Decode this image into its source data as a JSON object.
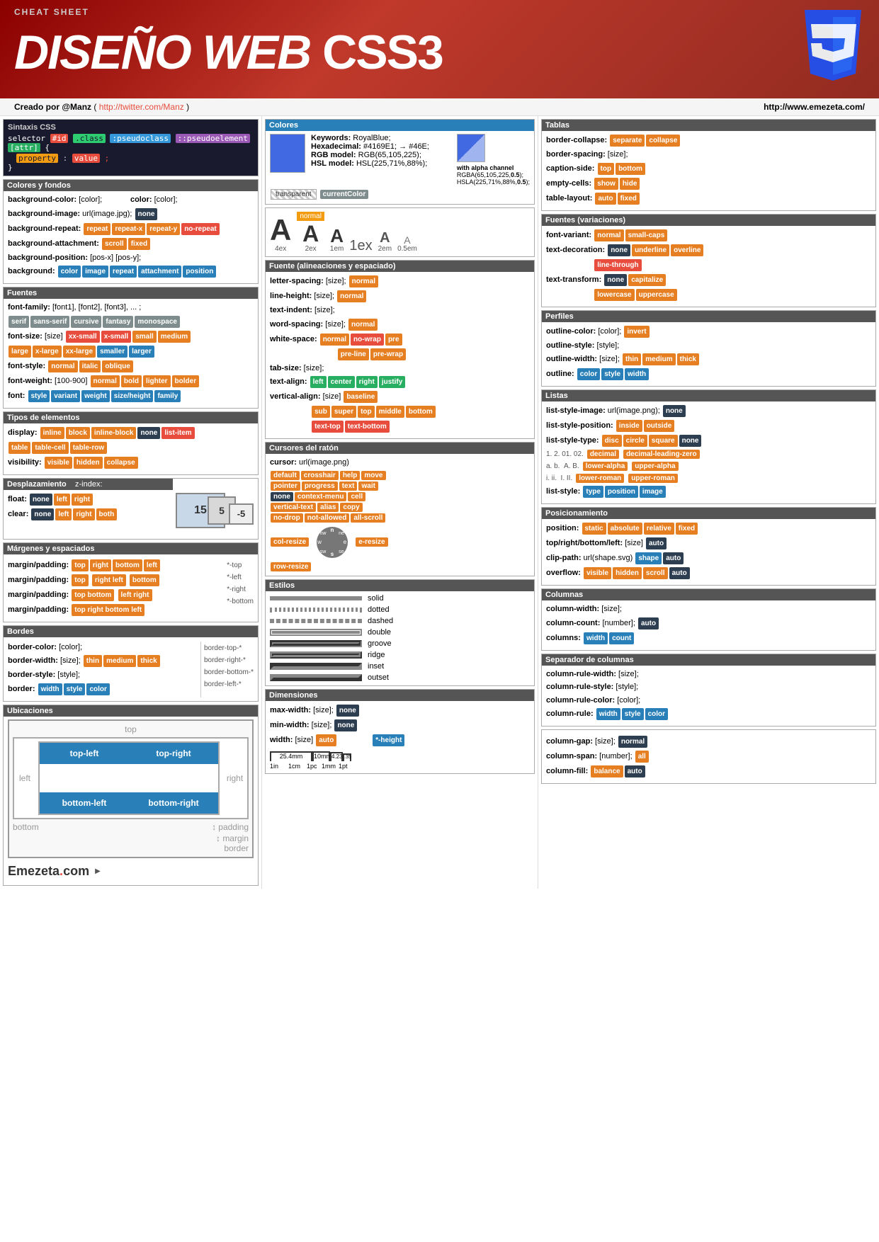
{
  "header": {
    "cheat_label": "CHEAT SHEET",
    "title": "DISEÑO WEB CSS3",
    "subtitle_left": "Creado por @Manz ( http://twitter.com/Manz )",
    "subtitle_right": "http://www.emezeta.com/"
  },
  "sintaxis": {
    "title": "Sintaxis CSS",
    "line1": "selector",
    "id": "#id",
    "class": ".class",
    "pseudo": ":pseudoclass",
    "pseudoel": "::pseudoelement",
    "attr": "[attr]",
    "property": "property",
    "value": "value"
  },
  "colores_section": {
    "title": "Colores",
    "keywords_label": "Keywords:",
    "keywords_val": "RoyalBlue;",
    "hex_label": "Hexadecimal:",
    "hex_val": "#4169E1; → #46E;",
    "rgb_label": "RGB model:",
    "rgb_val": "RGB(65,105,225);",
    "hsl_label": "HSL model:",
    "hsl_val": "HSL(225,71%,88%);",
    "alpha_label": "with alpha channel",
    "rgba_val": "RGBA(65,105,225,0.5);",
    "hsla_val": "HSLA(225,71%,88%,0.5);",
    "transparent": "transparent",
    "current": "currentColor"
  },
  "colores_fondos": {
    "title": "Colores y fondos",
    "props": [
      {
        "label": "background-color:",
        "vals": [
          "[color];"
        ],
        "extra": "color: [color];"
      },
      {
        "label": "background-image:",
        "vals": [
          "url(image.jpg);"
        ],
        "none": "none"
      },
      {
        "label": "background-repeat:",
        "tags": [
          "repeat",
          "repeat-x",
          "repeat-y",
          "no-repeat"
        ]
      },
      {
        "label": "background-attachment:",
        "tags": [
          "scroll",
          "fixed"
        ]
      },
      {
        "label": "background-position:",
        "vals": [
          "[pos-x] [pos-y];"
        ]
      },
      {
        "label": "background:",
        "tags": [
          "color",
          "image",
          "repeat",
          "attachment",
          "position"
        ]
      }
    ]
  },
  "fuentes": {
    "title": "Fuentes",
    "props": [
      {
        "label": "font-family:",
        "vals": [
          "[font1], [font2], [font3], ...;"
        ]
      },
      {
        "tags_serif": [
          "serif",
          "sans-serif",
          "cursive",
          "fantasy",
          "monospace"
        ]
      },
      {
        "label": "font-size:",
        "vals": [
          "[size]"
        ],
        "tags": [
          "xx-small",
          "x-small",
          "small",
          "medium",
          "large",
          "x-large",
          "xx-large",
          "smaller",
          "larger"
        ]
      },
      {
        "label": "font-style:",
        "tags": [
          "normal",
          "italic",
          "oblique"
        ]
      },
      {
        "label": "font-weight:",
        "vals": [
          "[100-900]"
        ],
        "tags": [
          "normal",
          "bold",
          "lighter",
          "bolder"
        ]
      },
      {
        "label": "font:",
        "tags": [
          "style",
          "variant",
          "weight",
          "size/height",
          "family"
        ]
      }
    ]
  },
  "tipos_elementos": {
    "title": "Tipos de elementos",
    "props": [
      {
        "label": "display:",
        "tags": [
          "inline",
          "block",
          "inline-block",
          "none",
          "list-item",
          "table",
          "table-cell",
          "table-row"
        ]
      },
      {
        "label": "visibility:",
        "tags": [
          "visible",
          "hidden",
          "collapse"
        ]
      }
    ]
  },
  "desplazamiento": {
    "title": "Desplazamiento",
    "zindex_label": "z-index:",
    "props": [
      {
        "label": "float:",
        "tags": [
          "none",
          "left",
          "right"
        ]
      },
      {
        "label": "clear:",
        "tags": [
          "none",
          "left",
          "right",
          "both"
        ]
      }
    ]
  },
  "margenes": {
    "title": "Márgenes y espaciados",
    "rows": [
      {
        "label": "margin/padding:",
        "tags": [
          "top",
          "right",
          "bottom",
          "left"
        ],
        "note": "*-top"
      },
      {
        "label": "margin/padding:",
        "tags": [
          "top",
          "right",
          "left"
        ],
        "tag2": [
          "bottom"
        ],
        "note": "*-left"
      },
      {
        "label": "margin/padding:",
        "tags": [
          "top",
          "left"
        ],
        "tag2": [
          "right"
        ],
        "note": "*-right"
      },
      {
        "label": "margin/padding:",
        "tags": [
          "top",
          "bottom"
        ],
        "tag2": [
          "left right"
        ],
        "note": ""
      },
      {
        "label": "margin/padding:",
        "tags": [
          "top right bottom left"
        ],
        "note": "*-bottom"
      }
    ]
  },
  "bordes": {
    "title": "Bordes",
    "props": [
      {
        "label": "border-color:",
        "vals": [
          "[color];"
        ]
      },
      {
        "label": "border-width:",
        "vals": [
          "[size];"
        ],
        "tags": [
          "thin",
          "medium",
          "thick"
        ]
      },
      {
        "label": "border-style:",
        "vals": [
          "[style];"
        ]
      },
      {
        "label": "border:",
        "tags": [
          "width",
          "style",
          "color"
        ]
      }
    ],
    "side_props": [
      "border-top-*",
      "border-right-*",
      "border-bottom-*",
      "border-left-*"
    ]
  },
  "ubicaciones": {
    "title": "Ubicaciones",
    "top": "top",
    "bottom": "bottom",
    "left": "left",
    "right": "right",
    "top_left": "top-left",
    "top_right": "top-right",
    "bottom_left": "bottom-left",
    "bottom_right": "bottom-right",
    "padding_label": "padding",
    "margin_label": "margin",
    "border_label": "border"
  },
  "fuente_alineaciones": {
    "title": "Fuente (alineaciones y espaciado)",
    "props": [
      {
        "label": "letter-spacing:",
        "vals": [
          "[size];"
        ],
        "tags": [
          "normal"
        ]
      },
      {
        "label": "line-height:",
        "vals": [
          "[size];"
        ],
        "tags": [
          "normal"
        ]
      },
      {
        "label": "text-indent:",
        "vals": [
          "[size];"
        ]
      },
      {
        "label": "word-spacing:",
        "vals": [
          "[size];"
        ],
        "tags": [
          "normal"
        ]
      },
      {
        "label": "white-space:",
        "tags": [
          "normal",
          "no-wrap",
          "pre",
          "pre-line",
          "pre-wrap"
        ]
      },
      {
        "label": "tab-size:",
        "vals": [
          "[size];"
        ]
      },
      {
        "label": "text-align:",
        "tags": [
          "left",
          "center",
          "right",
          "justify"
        ]
      },
      {
        "label": "vertical-align:",
        "vals": [
          "[size]"
        ],
        "tags": [
          "baseline",
          "sub",
          "super",
          "top",
          "middle",
          "bottom",
          "text-top",
          "text-bottom"
        ]
      }
    ]
  },
  "cursores": {
    "title": "Cursores del ratón",
    "cursor_url": "cursor: url(image.png)",
    "cursors": [
      [
        "default",
        "crosshair",
        "help",
        "move"
      ],
      [
        "pointer",
        "progress",
        "text",
        "wait"
      ],
      [
        "none",
        "context-menu",
        "cell"
      ],
      [
        "vertical-text",
        "alias",
        "copy"
      ],
      [
        "no-drop",
        "not-allowed",
        "all-scroll"
      ],
      [
        "col-resize"
      ],
      [
        "row-resize"
      ]
    ],
    "resize_tags": [
      "e-resize"
    ]
  },
  "estilos": {
    "title": "Estilos",
    "styles": [
      "solid",
      "dotted",
      "dashed",
      "double",
      "groove",
      "ridge",
      "inset",
      "outset"
    ]
  },
  "dimensiones": {
    "title": "Dimensiones",
    "props": [
      {
        "label": "max-width:",
        "vals": [
          "[size];"
        ],
        "tags": [
          "none"
        ]
      },
      {
        "label": "min-width:",
        "vals": [
          "[size];"
        ],
        "tags": [
          "none"
        ]
      },
      {
        "label": "width:",
        "vals": [
          "[size]"
        ],
        "tags": [
          "auto"
        ]
      }
    ],
    "height_tag": "*-height",
    "ruler": [
      "25.4mm",
      "10mm",
      "4.23mm",
      "0.35mm",
      "1in",
      "1cm",
      "1pc",
      "1mm",
      "1pt"
    ]
  },
  "tablas": {
    "title": "Tablas",
    "props": [
      {
        "label": "border-collapse:",
        "tags": [
          "separate",
          "collapse"
        ]
      },
      {
        "label": "border-spacing:",
        "vals": [
          "[size];"
        ]
      },
      {
        "label": "caption-side:",
        "tags": [
          "top",
          "bottom"
        ]
      },
      {
        "label": "empty-cells:",
        "tags": [
          "show",
          "hide"
        ]
      },
      {
        "label": "table-layout:",
        "tags": [
          "auto",
          "fixed"
        ]
      }
    ]
  },
  "fuentes_variaciones": {
    "title": "Fuentes (variaciones)",
    "props": [
      {
        "label": "font-variant:",
        "tags": [
          "normal",
          "small-caps"
        ]
      },
      {
        "label": "text-decoration:",
        "tags": [
          "none",
          "underline",
          "overline",
          "line-through"
        ]
      },
      {
        "label": "text-transform:",
        "tags": [
          "none",
          "capitalize",
          "lowercase",
          "uppercase"
        ]
      }
    ]
  },
  "perfiles": {
    "title": "Perfiles",
    "props": [
      {
        "label": "outline-color:",
        "vals": [
          "[color];"
        ],
        "tags": [
          "invert"
        ]
      },
      {
        "label": "outline-style:",
        "vals": [
          "[style];"
        ]
      },
      {
        "label": "outline-width:",
        "vals": [
          "[size];"
        ],
        "tags": [
          "thin",
          "medium",
          "thick"
        ]
      },
      {
        "label": "outline:",
        "tags": [
          "color",
          "style",
          "width"
        ]
      }
    ]
  },
  "listas": {
    "title": "Listas",
    "props": [
      {
        "label": "list-style-image:",
        "vals": [
          "url(image.png);"
        ],
        "tags": [
          "none"
        ]
      },
      {
        "label": "list-style-position:",
        "tags": [
          "inside",
          "outside"
        ]
      },
      {
        "label": "list-style-type:",
        "tags": [
          "disc",
          "circle",
          "square",
          "none"
        ]
      },
      {
        "label2": "decimal",
        "tags2": [
          "decimal",
          "decimal-leading-zero"
        ]
      },
      {
        "label2": "lower-alpha",
        "tags2": [
          "lower-alpha",
          "upper-alpha"
        ]
      },
      {
        "label2": "lower-roman",
        "tags2": [
          "lower-roman",
          "upper-roman"
        ]
      },
      {
        "label": "list-style:",
        "tags": [
          "type",
          "position",
          "image"
        ]
      }
    ]
  },
  "posicionamiento": {
    "title": "Posicionamiento",
    "props": [
      {
        "label": "position:",
        "tags": [
          "static",
          "absolute",
          "relative",
          "fixed"
        ]
      },
      {
        "label": "top/right/bottom/left:",
        "vals": [
          "[size]"
        ],
        "tags": [
          "auto"
        ]
      },
      {
        "label": "clip-path:",
        "vals": [
          "url(shape.svg)"
        ],
        "tags": [
          "shape",
          "auto"
        ]
      },
      {
        "label": "overflow:",
        "tags": [
          "visible",
          "hidden",
          "scroll",
          "auto"
        ]
      }
    ]
  },
  "columnas": {
    "title": "Columnas",
    "props": [
      {
        "label": "column-width:",
        "vals": [
          "[size];"
        ]
      },
      {
        "label": "column-count:",
        "vals": [
          "[number];"
        ],
        "tags": [
          "auto"
        ]
      },
      {
        "label": "columns:",
        "tags": [
          "width",
          "count"
        ]
      }
    ]
  },
  "separador": {
    "title": "Separador de columnas",
    "props": [
      {
        "label": "column-rule-width:",
        "vals": [
          "[size];"
        ]
      },
      {
        "label": "column-rule-style:",
        "vals": [
          "[style];"
        ]
      },
      {
        "label": "column-rule-color:",
        "vals": [
          "[color];"
        ]
      },
      {
        "label": "column-rule:",
        "tags": [
          "width",
          "style",
          "color"
        ]
      }
    ]
  },
  "column_extras": {
    "props": [
      {
        "label": "column-gap:",
        "vals": [
          "[size];"
        ],
        "tags": [
          "normal"
        ]
      },
      {
        "label": "column-span:",
        "vals": [
          "[number];"
        ],
        "tags": [
          "all"
        ]
      },
      {
        "label": "column-fill:",
        "tags": [
          "balance",
          "auto"
        ]
      }
    ]
  }
}
